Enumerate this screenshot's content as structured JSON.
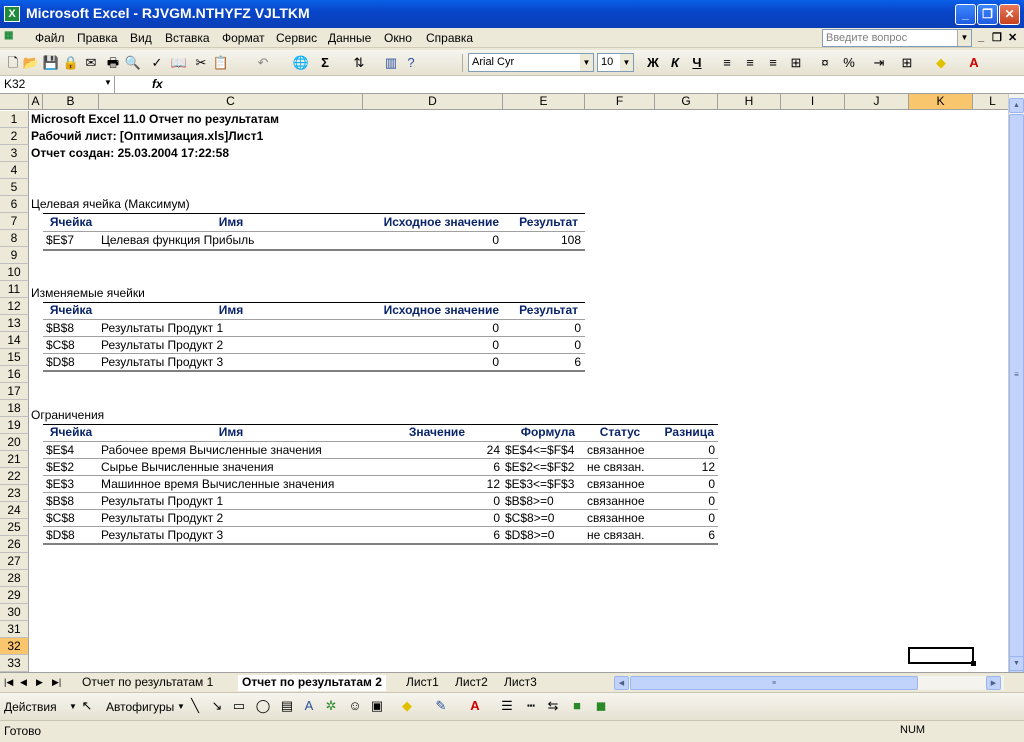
{
  "window": {
    "title": "Microsoft Excel - RJVGM.NTHYFZ VJLTKM",
    "app_icon": "X"
  },
  "menu": {
    "items": [
      "Файл",
      "Правка",
      "Вид",
      "Вставка",
      "Формат",
      "Сервис",
      "Данные",
      "Окно",
      "Справка"
    ],
    "help_placeholder": "Введите вопрос"
  },
  "toolbar": {
    "font": "Arial Cyr",
    "size": "10",
    "bold": "Ж",
    "italic": "К",
    "underline": "Ч",
    "sigma": "Σ",
    "percent": "%"
  },
  "formula_bar": {
    "name_box": "K32",
    "fx": "fx",
    "content": ""
  },
  "columns": [
    "A",
    "B",
    "C",
    "D",
    "E",
    "F",
    "G",
    "H",
    "I",
    "J",
    "K",
    "L"
  ],
  "active_column": "K",
  "active_row": "32",
  "rows": [
    "1",
    "2",
    "3",
    "4",
    "5",
    "6",
    "7",
    "8",
    "9",
    "10",
    "11",
    "12",
    "13",
    "14",
    "15",
    "16",
    "17",
    "18",
    "19",
    "20",
    "21",
    "22",
    "23",
    "24",
    "25",
    "26",
    "27",
    "28",
    "29",
    "30",
    "31",
    "32",
    "33"
  ],
  "report": {
    "line1": "Microsoft Excel 11.0 Отчет по результатам",
    "line2": "Рабочий лист: [Оптимизация.xls]Лист1",
    "line3": "Отчет создан: 25.03.2004 17:22:58",
    "target": {
      "title": "Целевая ячейка (Максимум)",
      "headers": [
        "Ячейка",
        "Имя",
        "Исходное значение",
        "Результат"
      ],
      "rows": [
        [
          "$E$7",
          "Целевая функция Прибыль",
          "0",
          "108"
        ]
      ]
    },
    "changing": {
      "title": "Изменяемые ячейки",
      "headers": [
        "Ячейка",
        "Имя",
        "Исходное значение",
        "Результат"
      ],
      "rows": [
        [
          "$B$8",
          "Результаты Продукт 1",
          "0",
          "0"
        ],
        [
          "$C$8",
          "Результаты Продукт 2",
          "0",
          "0"
        ],
        [
          "$D$8",
          "Результаты Продукт 3",
          "0",
          "6"
        ]
      ]
    },
    "constraints": {
      "title": "Ограничения",
      "headers": [
        "Ячейка",
        "Имя",
        "Значение",
        "Формула",
        "Статус",
        "Разница"
      ],
      "rows": [
        [
          "$E$4",
          "Рабочее время Вычисленные значения",
          "24",
          "$E$4<=$F$4",
          "связанное",
          "0"
        ],
        [
          "$E$2",
          "Сырье Вычисленные значения",
          "6",
          "$E$2<=$F$2",
          "не связан.",
          "12"
        ],
        [
          "$E$3",
          "Машинное время Вычисленные значения",
          "12",
          "$E$3<=$F$3",
          "связанное",
          "0"
        ],
        [
          "$B$8",
          "Результаты Продукт 1",
          "0",
          "$B$8>=0",
          "связанное",
          "0"
        ],
        [
          "$C$8",
          "Результаты Продукт 2",
          "0",
          "$C$8>=0",
          "связанное",
          "0"
        ],
        [
          "$D$8",
          "Результаты Продукт 3",
          "6",
          "$D$8>=0",
          "не связан.",
          "6"
        ]
      ]
    }
  },
  "sheet_tabs": [
    "Отчет по результатам 1",
    "Отчет по результатам 2",
    "Лист1",
    "Лист2",
    "Лист3"
  ],
  "active_tab": "Отчет по результатам 2",
  "drawbar": {
    "actions": "Действия",
    "autoshapes": "Автофигуры"
  },
  "status": {
    "text": "Готово",
    "num": "NUM"
  }
}
